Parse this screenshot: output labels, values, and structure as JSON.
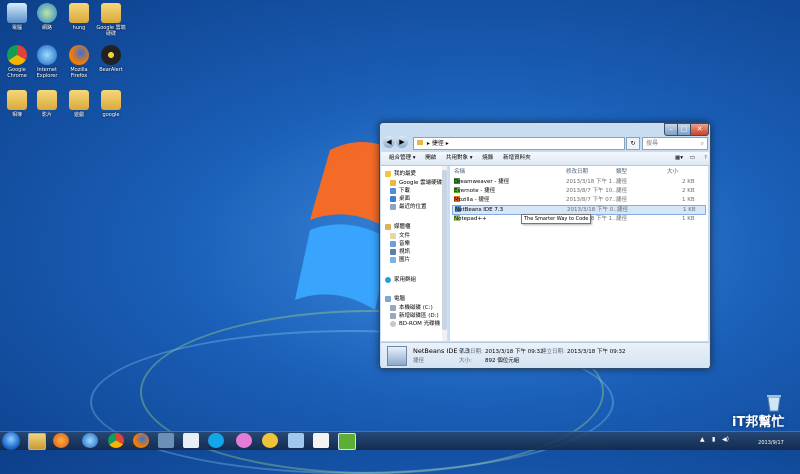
{
  "desktop_icons": [
    {
      "label": "電腦",
      "icon": "computer-icon"
    },
    {
      "label": "網路",
      "icon": "network-icon"
    },
    {
      "label": "hung",
      "icon": "user-folder-icon"
    },
    {
      "label": "Google 雲端硬碟",
      "icon": "google-drive-icon"
    },
    {
      "label": "Google Chrome",
      "icon": "chrome-icon"
    },
    {
      "label": "Internet Explorer",
      "icon": "ie-icon"
    },
    {
      "label": "Mozilla Firefox",
      "icon": "firefox-icon"
    },
    {
      "label": "BearAlert",
      "icon": "bear-icon"
    },
    {
      "label": "相簿",
      "icon": "folder-icon"
    },
    {
      "label": "影片",
      "icon": "folder-icon"
    },
    {
      "label": "遊戲",
      "icon": "folder-icon"
    },
    {
      "label": "google",
      "icon": "folder-icon"
    }
  ],
  "window": {
    "address": "▸ 捷徑 ▸",
    "search_placeholder": "搜尋",
    "toolbar": [
      "組合管理 ▾",
      "開啟",
      "共用對象 ▾",
      "燒錄",
      "新增資料夾"
    ],
    "nav": {
      "favorites": "我的最愛",
      "fav_items": [
        "Google 雲端硬碟",
        "下載",
        "桌面",
        "最近的位置"
      ],
      "libraries": "媒體櫃",
      "lib_items": [
        "文件",
        "音樂",
        "視訊",
        "圖片"
      ],
      "homegroup": "家用群組",
      "computer": "電腦",
      "comp_items": [
        "本機磁碟 (C:)",
        "新增磁碟區 (D:)",
        "BD-ROM 光碟機"
      ]
    },
    "columns": [
      "名稱",
      "修改日期",
      "類型",
      "大小"
    ],
    "files": [
      {
        "name": "Dreamweaver - 捷徑",
        "date": "2013/3/18 下午 1...",
        "type": "捷徑",
        "size": "2 KB"
      },
      {
        "name": "Evernote - 捷徑",
        "date": "2013/8/7 下午 10...",
        "type": "捷徑",
        "size": "2 KB"
      },
      {
        "name": "Mozilla - 捷徑",
        "date": "2013/8/7 下午 07...",
        "type": "捷徑",
        "size": "1 KB"
      },
      {
        "name": "NetBeans IDE 7.3",
        "date": "2013/3/18 下午 0...",
        "type": "捷徑",
        "size": "1 KB"
      },
      {
        "name": "Notepad++",
        "date": "2013/3/18 下午 1...",
        "type": "捷徑",
        "size": "1 KB"
      }
    ],
    "tooltip": "The Smarter Way to Code",
    "details": {
      "name": "NetBeans IDE 7.3",
      "type": "捷徑",
      "modified_label": "修改日期:",
      "modified": "2013/3/18 下午 09:32",
      "created_label": "建立日期:",
      "created": "2013/3/18 下午 09:32",
      "size_label": "大小:",
      "size": "892 個位元組"
    }
  },
  "taskbar": {
    "date": "2013/9/17",
    "watermark": "iT邦幫忙"
  }
}
